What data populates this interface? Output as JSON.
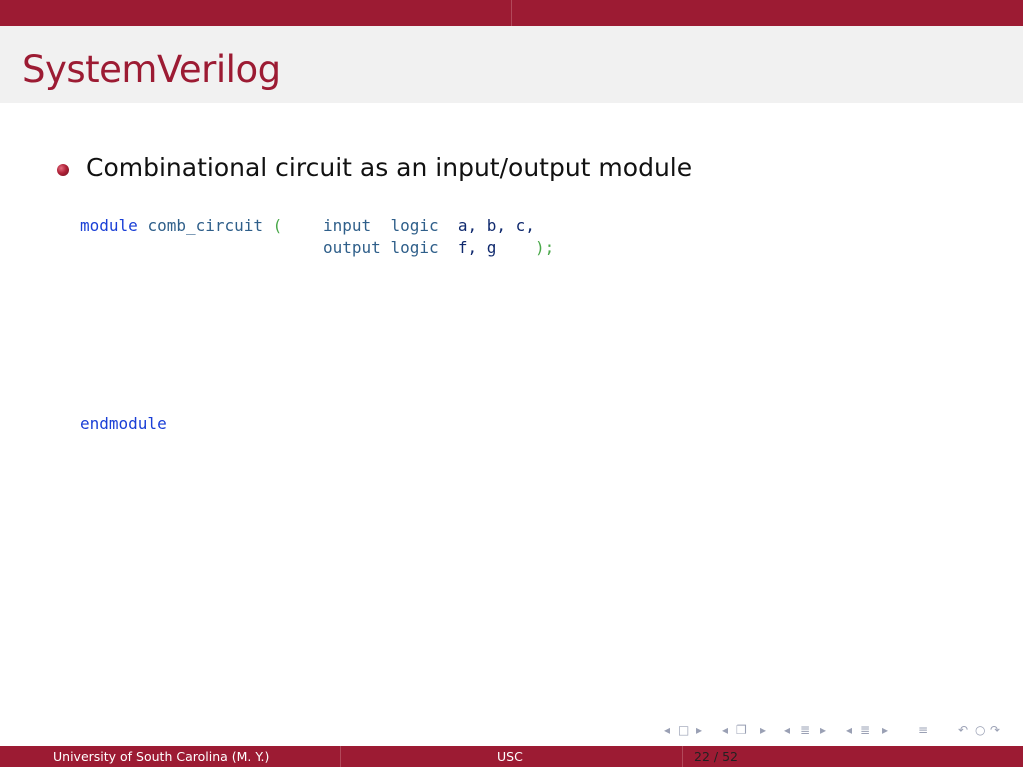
{
  "slide": {
    "title": "SystemVerilog",
    "bullet": "Combinational circuit as an input/output module"
  },
  "code": {
    "line1": {
      "keyword": "module",
      "name": "comb_circuit",
      "paren_open": "(",
      "dir": "input",
      "type": "logic",
      "signals": "a, b, c,"
    },
    "line2": {
      "dir": "output",
      "type": "logic",
      "signals": "f, g",
      "paren_close": ");"
    },
    "end": "endmodule"
  },
  "footer": {
    "author": "University of South Carolina  (M. Y.)",
    "institute": "USC",
    "page": "22 / 52"
  },
  "nav_icons": [
    "nav-prev-frame-icon",
    "nav-frame-icon",
    "nav-next-frame-icon",
    "nav-prev-subsection-icon",
    "nav-subsection-icon",
    "nav-next-subsection-icon",
    "nav-prev-section-icon",
    "nav-section-icon",
    "nav-next-section-icon",
    "nav-appendix-icon",
    "nav-search-back-icon",
    "nav-zoom-icon",
    "nav-search-forward-icon"
  ],
  "colors": {
    "brand": "#9c1b33",
    "title_bg": "#f1f1f1",
    "keyword": "#1a3fd6"
  }
}
